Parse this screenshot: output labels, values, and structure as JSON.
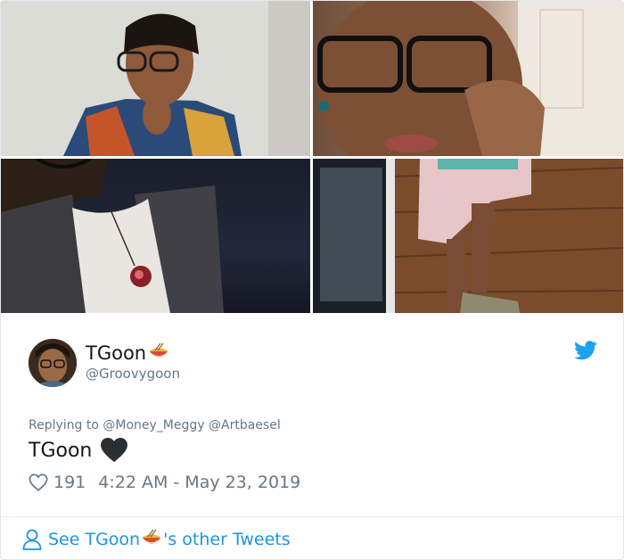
{
  "tweet": {
    "display_name": "TGoon",
    "handle": "@Groovygoon",
    "replying_to_prefix": "Replying to",
    "mentions": [
      "@Money_Meggy",
      "@Artbaesel"
    ],
    "text": "TGoon",
    "like_count": "191",
    "timestamp": "4:22 AM - May 23, 2019"
  },
  "footer": {
    "prefix": "See TGoon",
    "suffix": "'s other Tweets"
  },
  "media": {
    "photo_count": 4
  },
  "icons": {
    "brand": "twitter-bird-icon",
    "emoji_name": "ramen-bowl-icon",
    "emoji_text": "black-heart-icon",
    "like": "heart-outline-icon",
    "footer": "person-icon"
  },
  "colors": {
    "accent": "#1da1f2",
    "link": "#1b95e0",
    "muted": "#657786",
    "text": "#14171a",
    "border": "#e1e8ed"
  }
}
